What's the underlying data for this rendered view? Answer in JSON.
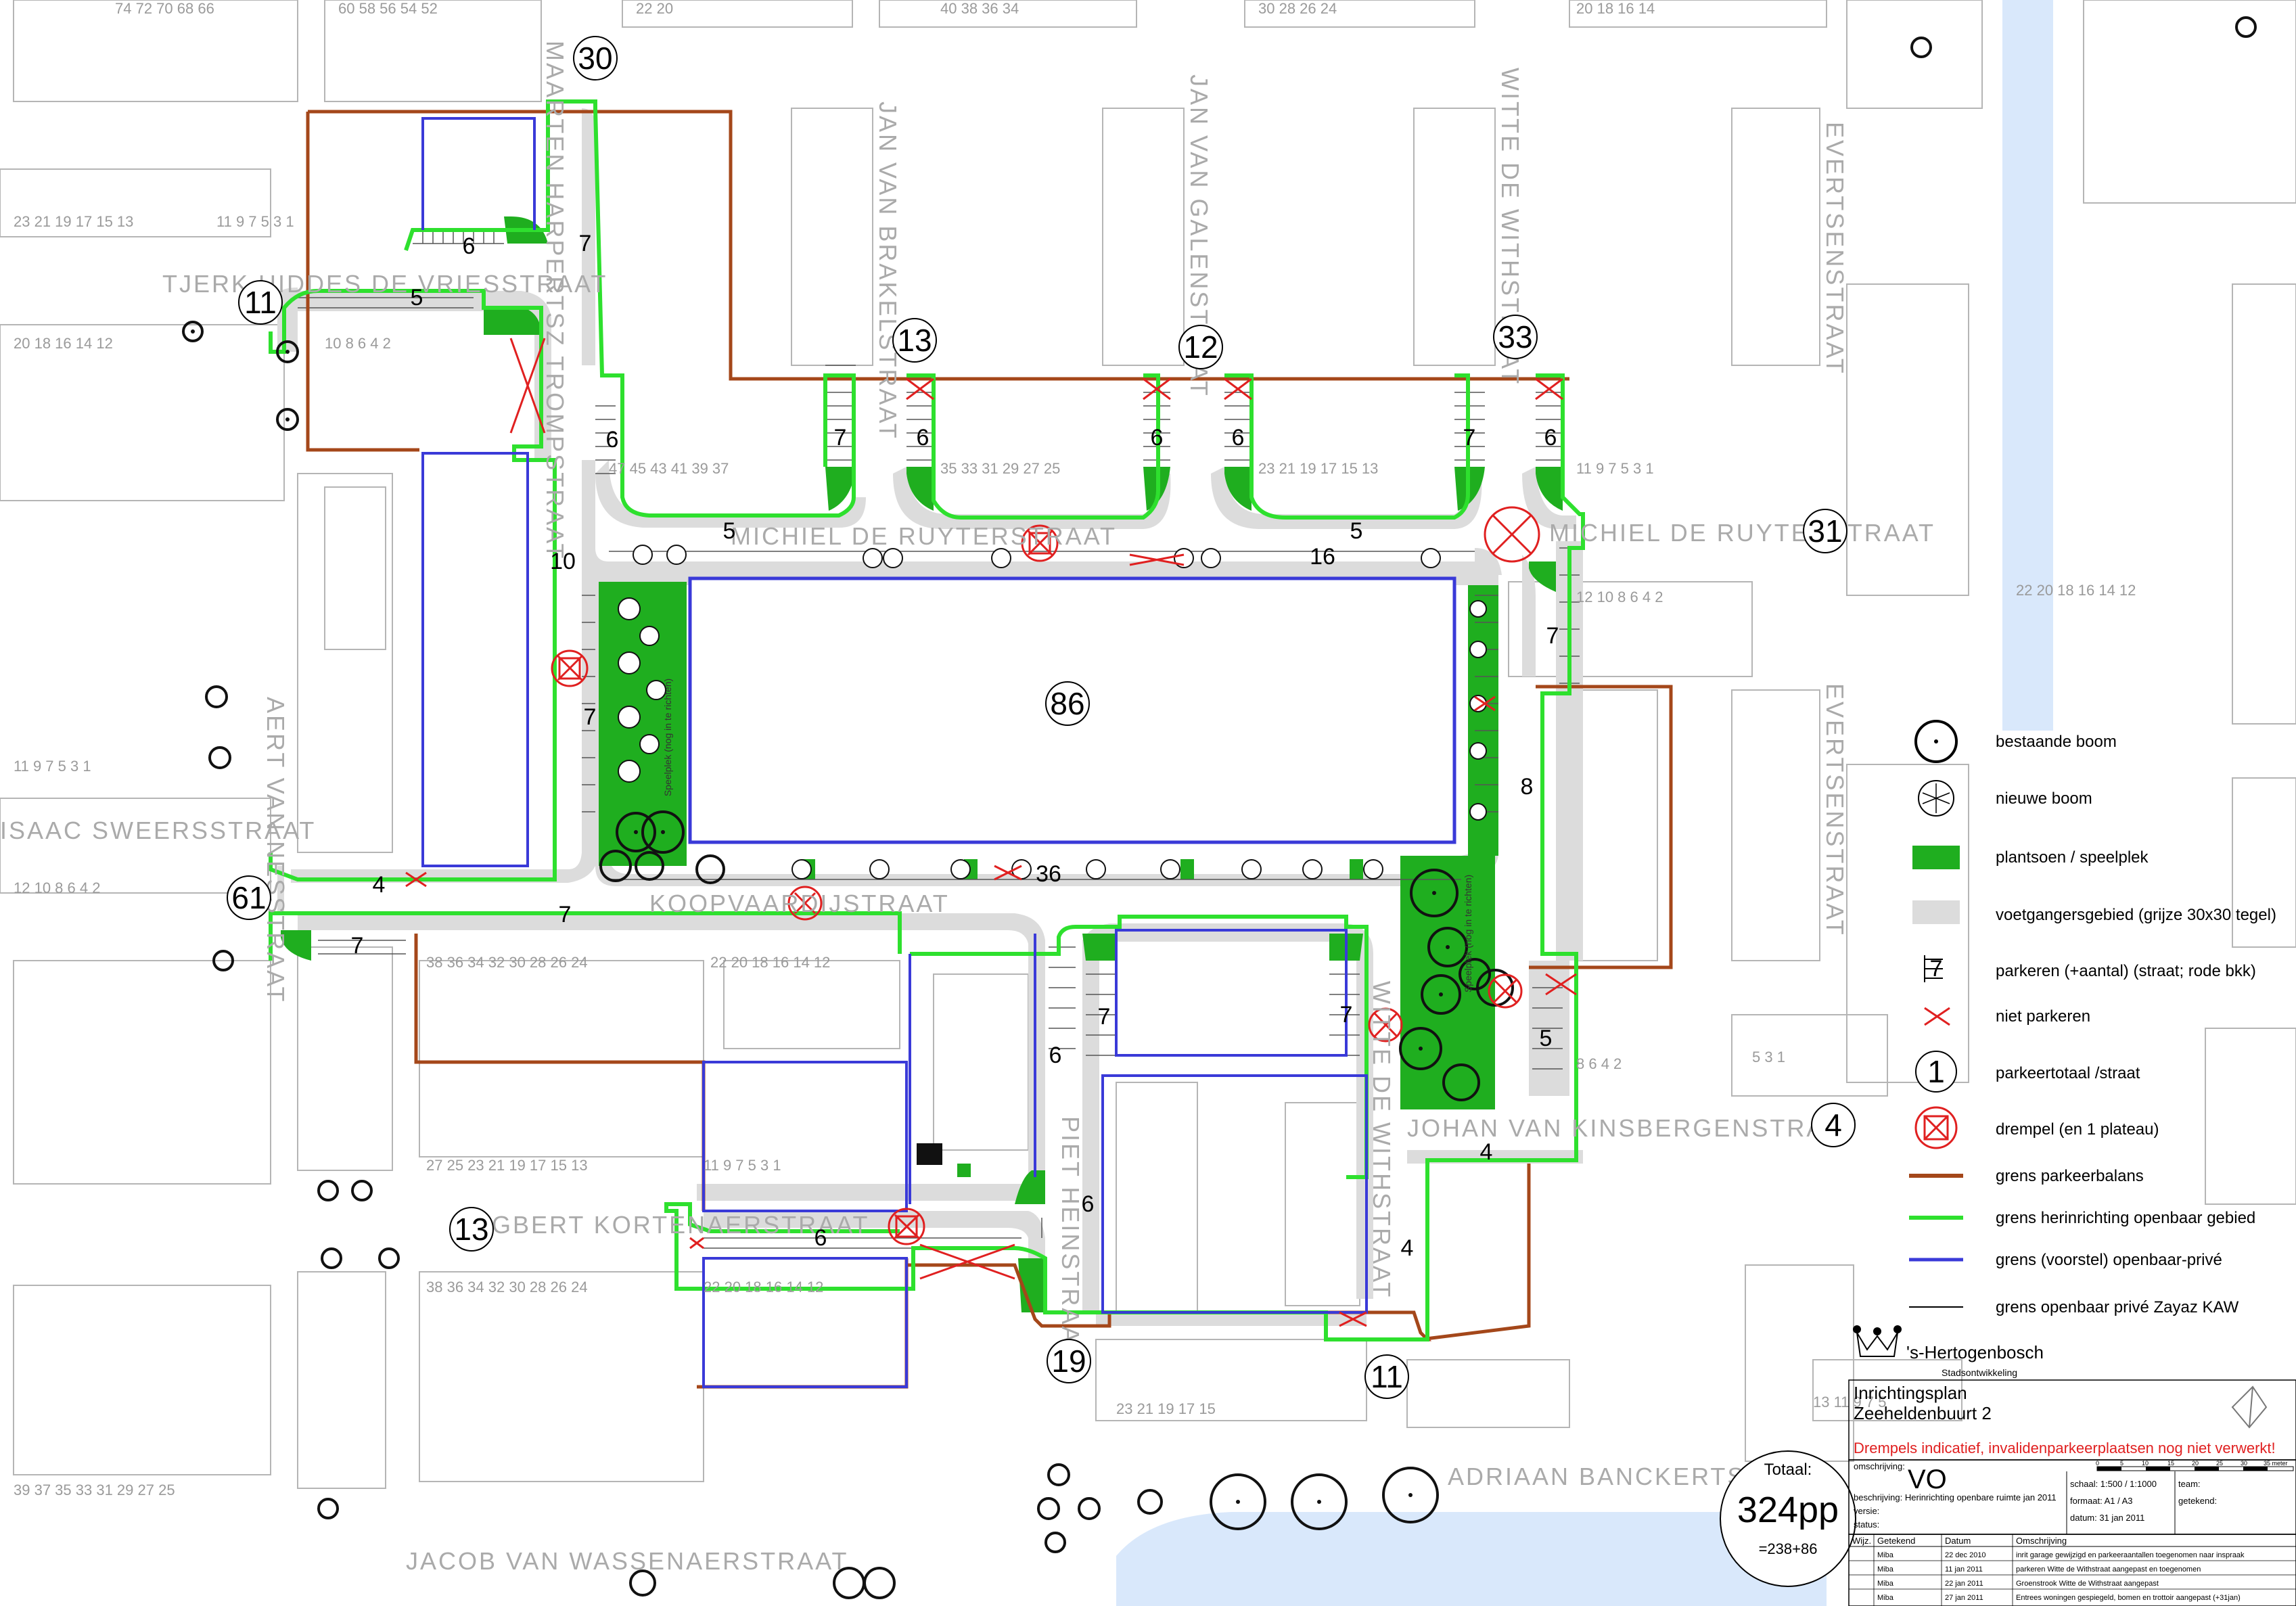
{
  "streets": [
    "TJERK HIDDES DE VRIESSTRAAT",
    "MAARTEN HARPERTSZ TROMPSTRAAT",
    "JAN VAN BRAKELSTRAAT",
    "JAN VAN GALENSTRAAT",
    "WITTE DE WITHSTRAAT",
    "EVERTSENSTRAAT",
    "MICHIEL DE RUYTERSTRAAT",
    "AERT VAN NESSTRAAT",
    "ISAAC SWEERSSTRAAT",
    "KOOPVAARDIJSTRAAT",
    "EGBERT KORTENAERSTRAAT",
    "PIET HEINSTRAAT",
    "JOHAN VAN KINSBERGENSTRAAT",
    "ADRIAAN BANCKERTSINGEL",
    "JACOB VAN WASSENAERSTRAAT"
  ],
  "street_totals": [
    "30",
    "11",
    "13",
    "12",
    "33",
    "31",
    "86",
    "61",
    "13",
    "19",
    "11",
    "4"
  ],
  "parking_counts": [
    "6",
    "7",
    "5",
    "6",
    "7",
    "6",
    "6",
    "6",
    "7",
    "6",
    "5",
    "5",
    "16",
    "10",
    "7",
    "7",
    "8",
    "36",
    "4",
    "7",
    "7",
    "7",
    "7",
    "6",
    "6",
    "6",
    "4",
    "5",
    "4"
  ],
  "speelplek_label": "Speelplek (nog in te richten)",
  "totaal": {
    "label": "Totaal:",
    "value": "324pp",
    "breakdown": "=238+86"
  },
  "legend": [
    {
      "icon": "bestaande-boom-icon",
      "label": "bestaande boom"
    },
    {
      "icon": "nieuwe-boom-icon",
      "label": "nieuwe boom"
    },
    {
      "icon": "plantsoen-icon",
      "label": "plantsoen / speelplek"
    },
    {
      "icon": "voetgangersgebied-icon",
      "label": "voetgangersgebied (grijze 30x30 tegel)"
    },
    {
      "icon": "parkeren-icon",
      "label": "parkeren (+aantal) (straat; rode bkk)"
    },
    {
      "icon": "niet-parkeren-icon",
      "label": "niet parkeren"
    },
    {
      "icon": "parkeertotaal-icon",
      "label": "parkeertotaal /straat"
    },
    {
      "icon": "drempel-icon",
      "label": "drempel (en 1 plateau)"
    },
    {
      "icon": "line-brown-icon",
      "label": "grens parkeerbalans"
    },
    {
      "icon": "line-green-icon",
      "label": "grens herinrichting openbaar gebied"
    },
    {
      "icon": "line-blue-icon",
      "label": "grens (voorstel) openbaar-privé"
    },
    {
      "icon": "line-black-icon",
      "label": "grens openbaar privé Zayaz KAW"
    }
  ],
  "legend_symbol_text": {
    "parkeren": "7",
    "parkeertotaal": "1"
  },
  "title_block": {
    "org_name": "'s-Hertogenbosch",
    "org_sub": "Stadsontwikkeling",
    "plan_title": "Inrichtingsplan",
    "plan_area": "Zeeheldenbuurt 2",
    "warning": "Drempels indicatief, invalidenparkeerplaatsen nog niet verwerkt!",
    "omschrijving_label": "omschrijving:",
    "phase": "VO",
    "beschrijving": "beschrijving:  Herinrichting openbare ruimte jan 2011",
    "versie": "versie:",
    "status": "status:",
    "schaal": "schaal: 1:500 / 1:1000",
    "formaat": "formaat: A1 / A3",
    "datum": "datum: 31 jan 2011",
    "team": "team:",
    "getekend_label": "getekend:",
    "scale_ticks": [
      "0",
      "5",
      "10",
      "15",
      "20",
      "25",
      "30",
      "35 meter"
    ],
    "rev_headers": [
      "Wijz.",
      "Getekend",
      "Datum",
      "Omschrijving"
    ],
    "revisions": [
      [
        "",
        "Miba",
        "22 dec 2010",
        "inrit garage gewijzigd en parkeeraantallen toegenomen naar inspraak"
      ],
      [
        "",
        "Miba",
        "11 jan 2011",
        "parkeren Witte de Withstraat aangepast en toegenomen"
      ],
      [
        "",
        "Miba",
        "22 jan 2011",
        "Groenstrook Witte de Withstraat aangepast"
      ],
      [
        "",
        "Miba",
        "27 jan 2011",
        "Entrees woningen gespiegeld, bomen en trottoir aangepast (+31jan)"
      ]
    ]
  },
  "colors": {
    "brown": "#a4471a",
    "green": "#2ee02e",
    "blue": "#3a3ad8",
    "plantsoen": "#1fae1f",
    "water": "#d9e8fb",
    "pavement": "#dcdcdc",
    "red": "#e02020"
  }
}
